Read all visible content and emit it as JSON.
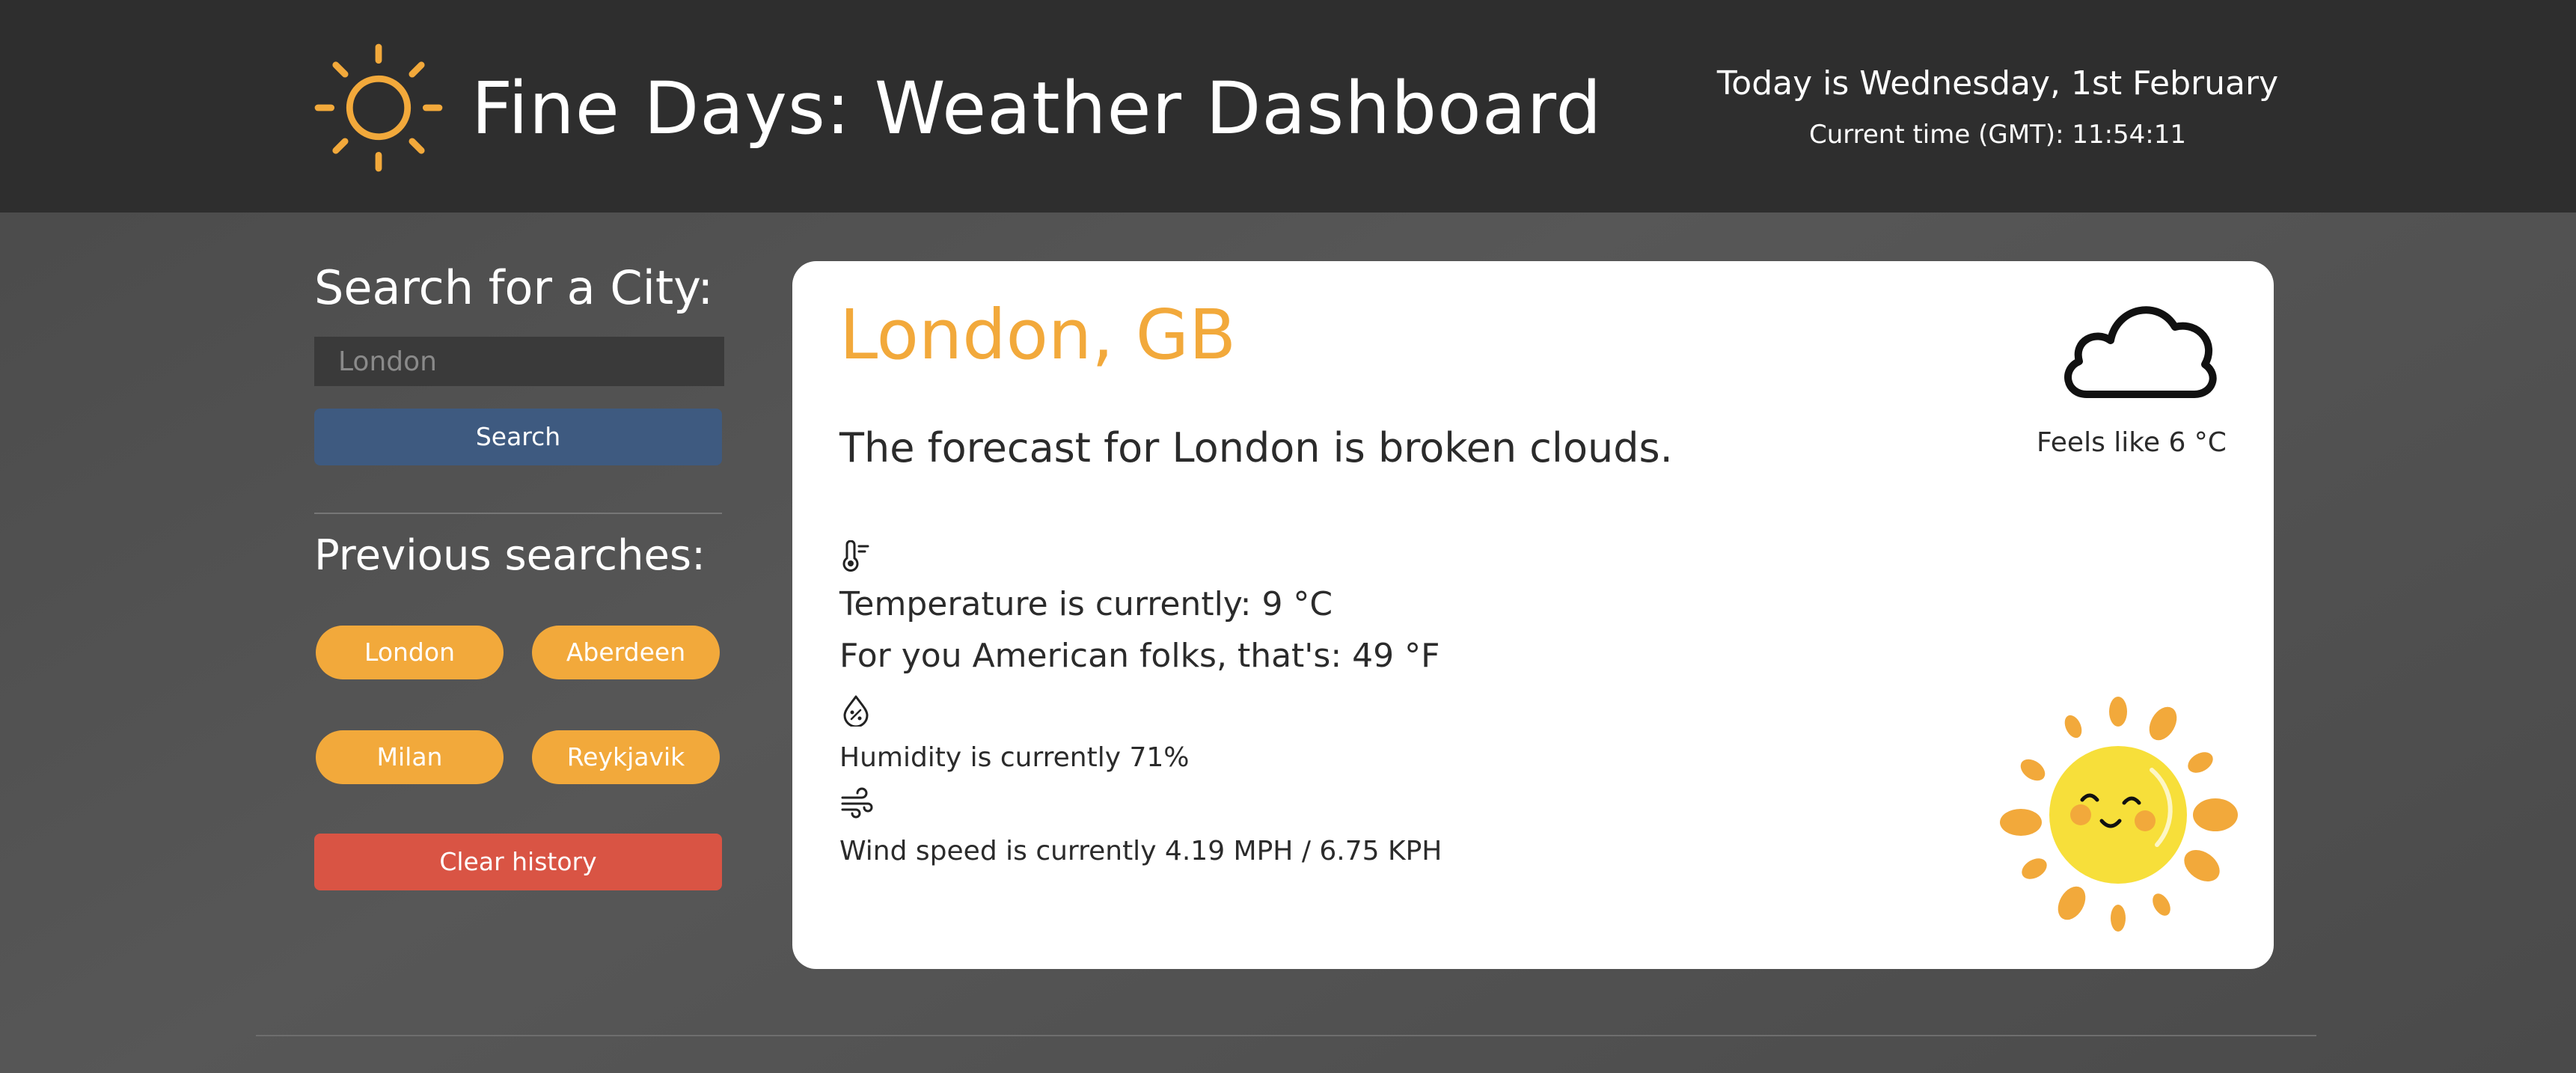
{
  "header": {
    "title": "Fine Days: Weather Dashboard",
    "date_text": "Today is Wednesday, 1st February",
    "time_text": "Current time (GMT): 11:54:11",
    "logo_icon": "sun-outline-icon"
  },
  "sidebar": {
    "search_heading": "Search for a City:",
    "search_placeholder": "London",
    "search_button": "Search",
    "previous_heading": "Previous searches:",
    "history": [
      "London",
      "Aberdeen",
      "Milan",
      "Reykjavik"
    ],
    "clear_button": "Clear history"
  },
  "weather": {
    "city": "London, GB",
    "forecast": "The forecast for London is broken clouds.",
    "condition_icon": "cloud-icon",
    "feels_like": "Feels like 6 °C",
    "temperature_c": "Temperature is currently: 9 °C",
    "temperature_f": "For you American folks, that's: 49 °F",
    "humidity": "Humidity is currently 71%",
    "wind": "Wind speed is currently 4.19 MPH / 6.75 KPH",
    "illustration": "smiling-sun-icon"
  },
  "colors": {
    "header_bg": "#2e2e2e",
    "accent_orange": "#f2a93b",
    "search_button": "#3e5a80",
    "clear_button": "#d95444",
    "card_bg": "#ffffff"
  }
}
